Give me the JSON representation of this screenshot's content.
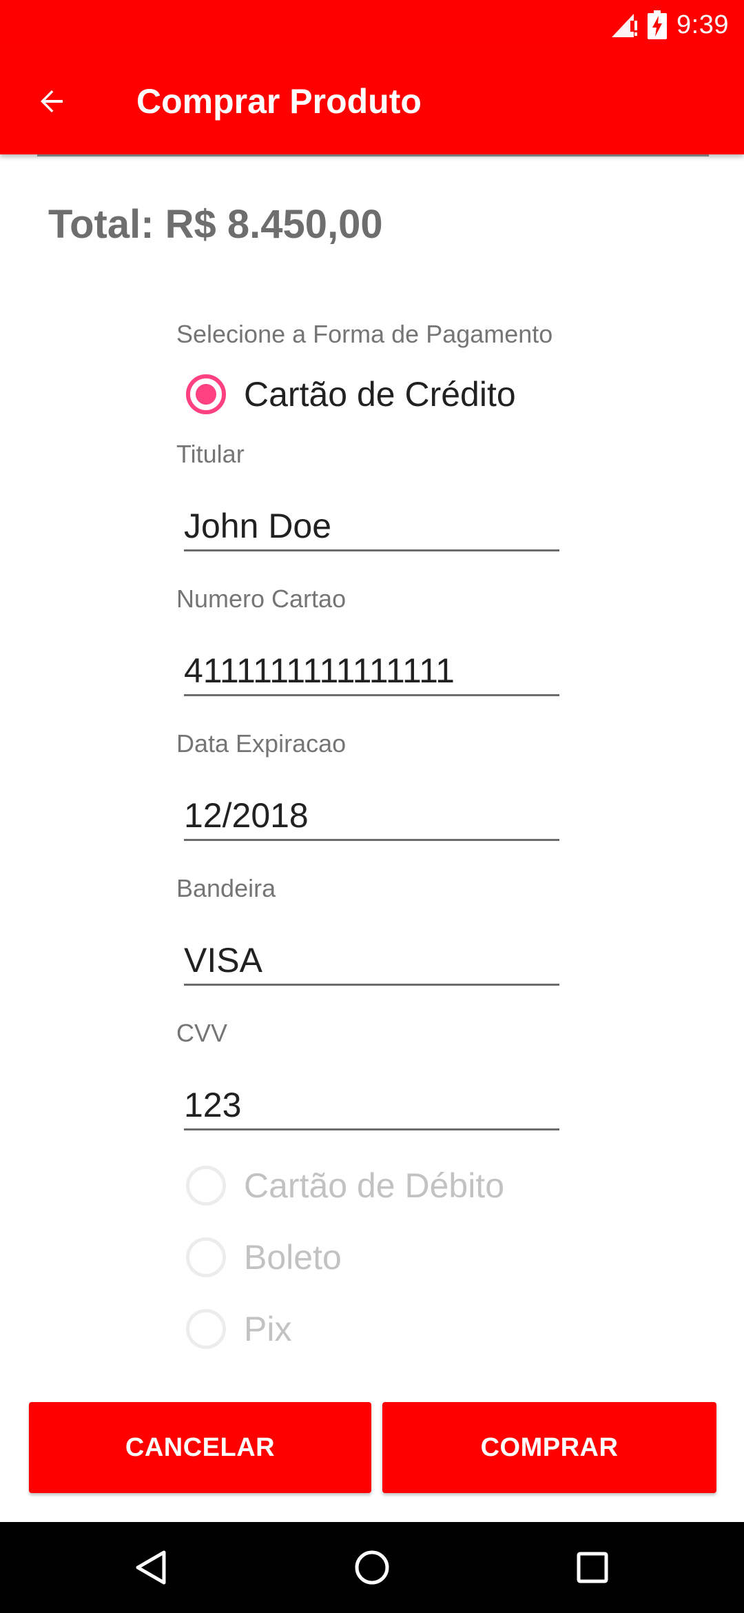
{
  "status_bar": {
    "time": "9:39",
    "icons": [
      "signal-icon",
      "battery-charging-icon"
    ]
  },
  "app_bar": {
    "title": "Comprar Produto",
    "back_icon": "arrow-back-icon"
  },
  "total": {
    "text": "Total: R$ 8.450,00"
  },
  "payment": {
    "section_label": "Selecione a Forma de Pagamento",
    "options": [
      {
        "label": "Cartão de Crédito",
        "checked": true,
        "enabled": true
      },
      {
        "label": "Cartão de Débito",
        "checked": false,
        "enabled": false
      },
      {
        "label": "Boleto",
        "checked": false,
        "enabled": false
      },
      {
        "label": "Pix",
        "checked": false,
        "enabled": false
      }
    ],
    "fields": [
      {
        "label": "Titular",
        "value": "John Doe"
      },
      {
        "label": "Numero Cartao",
        "value": "4111111111111111"
      },
      {
        "label": "Data Expiracao",
        "value": "12/2018"
      },
      {
        "label": "Bandeira",
        "value": "VISA"
      },
      {
        "label": "CVV",
        "value": "123"
      }
    ]
  },
  "actions": {
    "cancel_label": "CANCELAR",
    "buy_label": "COMPRAR"
  },
  "nav_bar": {
    "icons": [
      "nav-back-icon",
      "nav-home-icon",
      "nav-recents-icon"
    ]
  },
  "colors": {
    "primary": "#ff0000",
    "accent": "#ff4081",
    "text_primary": "#212121",
    "text_secondary": "#757575",
    "text_disabled": "#c2c2c2"
  }
}
